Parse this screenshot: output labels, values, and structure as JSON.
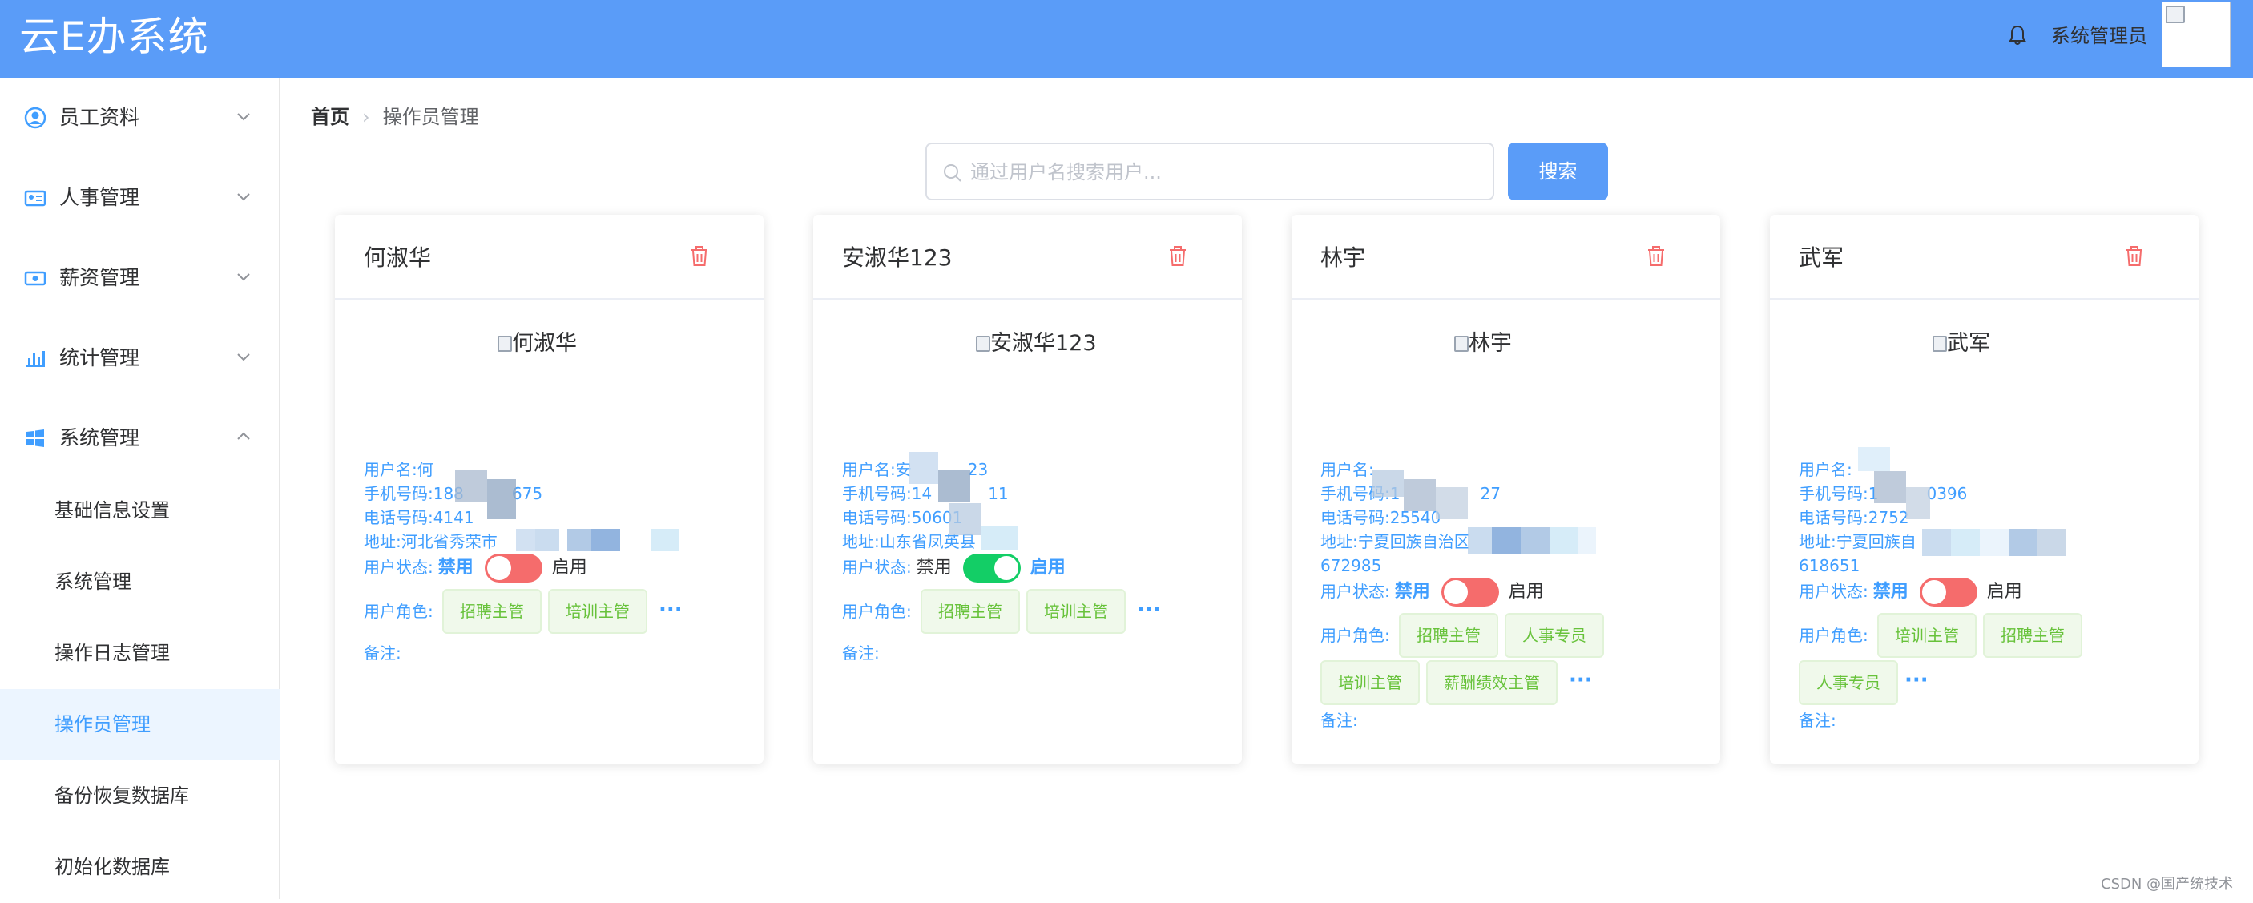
{
  "header": {
    "title": "云E办系统",
    "user_name": "系统管理员"
  },
  "sidebar": {
    "groups": [
      {
        "label": "员工资料",
        "icon": "user-circle-icon"
      },
      {
        "label": "人事管理",
        "icon": "id-card-icon"
      },
      {
        "label": "薪资管理",
        "icon": "money-icon"
      },
      {
        "label": "统计管理",
        "icon": "bar-chart-icon"
      },
      {
        "label": "系统管理",
        "icon": "windows-icon"
      }
    ],
    "sub_items": [
      "基础信息设置",
      "系统管理",
      "操作日志管理",
      "操作员管理",
      "备份恢复数据库",
      "初始化数据库"
    ]
  },
  "breadcrumb": {
    "home": "首页",
    "current": "操作员管理"
  },
  "search": {
    "placeholder": "通过用户名搜索用户...",
    "value": "",
    "button": "搜索"
  },
  "cards": [
    {
      "name": "何淑华",
      "photo_alt": "何淑华",
      "username": "用户名:何",
      "phone": "手机号码:188",
      "phone_tail": "675",
      "tel": "电话号码:4141",
      "address": "地址:河北省秀荣市",
      "address_2": "",
      "status_label": "用户状态:",
      "disabled": "禁用",
      "enabled": "启用",
      "is_enabled": false,
      "roles_label": "用户角色:",
      "roles": [
        "招聘主管",
        "培训主管"
      ],
      "more": "···",
      "remark": "备注:"
    },
    {
      "name": "安淑华123",
      "photo_alt": "安淑华123",
      "username": "用户名:安",
      "username_tail": "23",
      "phone": "手机号码:14",
      "phone_tail": "11",
      "tel": "电话号码:50601",
      "address": "地址:山东省凤英县",
      "address_2": "",
      "status_label": "用户状态:",
      "disabled": "禁用",
      "enabled": "启用",
      "is_enabled": true,
      "roles_label": "用户角色:",
      "roles": [
        "招聘主管",
        "培训主管"
      ],
      "more": "···",
      "remark": "备注:"
    },
    {
      "name": "林宇",
      "photo_alt": "林宇",
      "username": "用户名:",
      "phone": "手机号码:1",
      "phone_tail": "27",
      "tel": "电话号码:25540",
      "address": "地址:宁夏回族自治区",
      "address_2": "672985",
      "status_label": "用户状态:",
      "disabled": "禁用",
      "enabled": "启用",
      "is_enabled": false,
      "roles_label": "用户角色:",
      "roles": [
        "招聘主管",
        "人事专员",
        "培训主管",
        "薪酬绩效主管"
      ],
      "more": "···",
      "remark": "备注:"
    },
    {
      "name": "武军",
      "photo_alt": "武军",
      "username": "用户名:",
      "phone": "手机号码:1",
      "phone_tail": "0396",
      "tel": "电话号码:2752",
      "address": "地址:宁夏回族自",
      "address_2": "618651",
      "status_label": "用户状态:",
      "disabled": "禁用",
      "enabled": "启用",
      "is_enabled": false,
      "roles_label": "用户角色:",
      "roles": [
        "培训主管",
        "招聘主管",
        "人事专员"
      ],
      "more": "···",
      "remark": "备注:"
    }
  ],
  "watermark": "CSDN @国产统技术",
  "colors": {
    "header": "#5a9cf8",
    "link": "#409eff",
    "switch_off": "#f56c6c",
    "switch_on": "#13ce66",
    "tag_text": "#67c23a",
    "tag_bg": "#f0f9eb",
    "delete": "#f56c6c"
  }
}
